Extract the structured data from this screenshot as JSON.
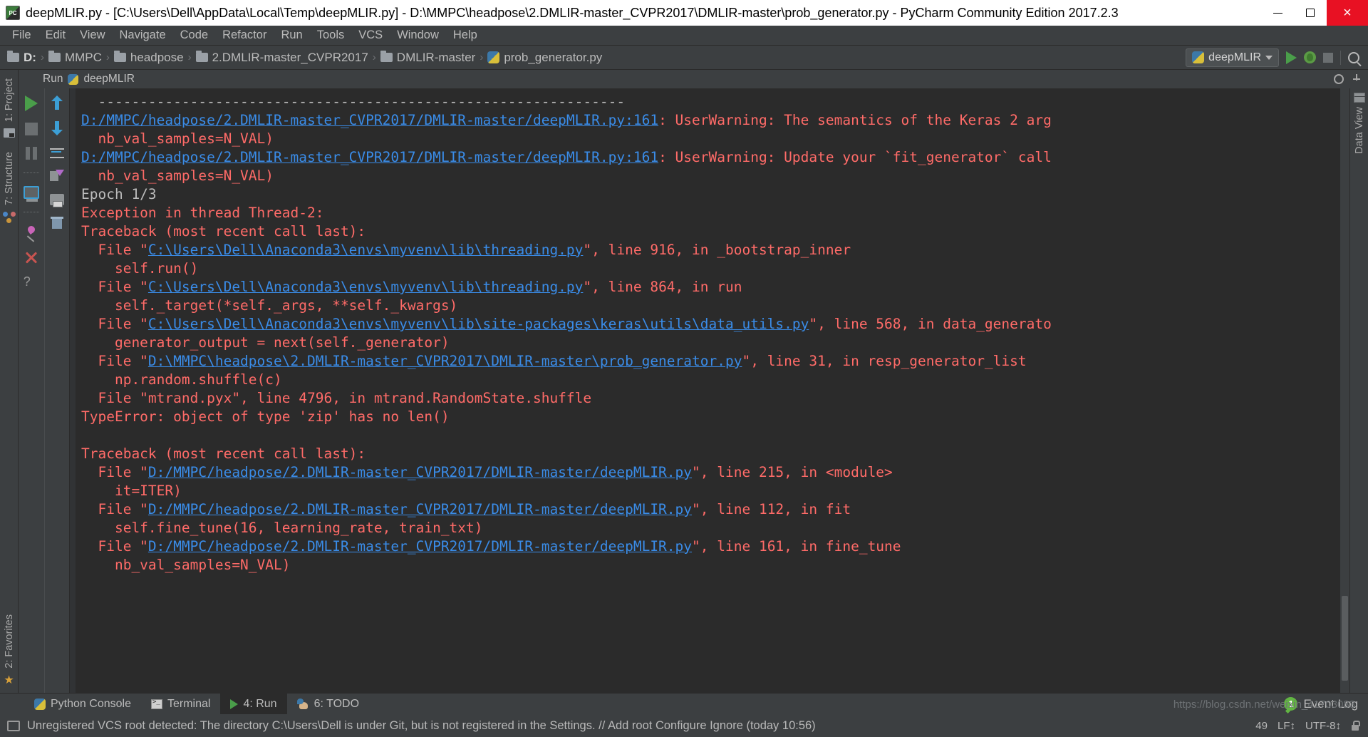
{
  "titlebar": {
    "title": "deepMLIR.py - [C:\\Users\\Dell\\AppData\\Local\\Temp\\deepMLIR.py] - D:\\MMPC\\headpose\\2.DMLIR-master_CVPR2017\\DMLIR-master\\prob_generator.py - PyCharm Community Edition 2017.2.3",
    "minimize_label": "",
    "maximize_label": "",
    "close_label": "×"
  },
  "menubar": {
    "items": [
      "File",
      "Edit",
      "View",
      "Navigate",
      "Code",
      "Refactor",
      "Run",
      "Tools",
      "VCS",
      "Window",
      "Help"
    ]
  },
  "breadcrumb": {
    "items": [
      {
        "label": "D:",
        "icon": "folder-icon"
      },
      {
        "label": "MMPC",
        "icon": "folder-icon"
      },
      {
        "label": "headpose",
        "icon": "folder-icon"
      },
      {
        "label": "2.DMLIR-master_CVPR2017",
        "icon": "folder-icon"
      },
      {
        "label": "DMLIR-master",
        "icon": "folder-icon"
      },
      {
        "label": "prob_generator.py",
        "icon": "python-file-icon"
      }
    ],
    "separator": "›"
  },
  "toolbar_right": {
    "run_config": "deepMLIR",
    "run_button": "run-icon",
    "debug_button": "debug-icon",
    "stop_button": "stop-icon",
    "search_button": "search-icon"
  },
  "left_rail": {
    "project_tab": "1: Project",
    "structure_tab": "7: Structure",
    "favorites_tab": "2: Favorites"
  },
  "right_rail": {
    "data_view_tab": "Data View"
  },
  "run_window": {
    "title": "Run",
    "config_name": "deepMLIR",
    "toolbar_col1": [
      "rerun-icon",
      "stop-icon",
      "pause-icon",
      "restart-icon",
      "pin-icon",
      "close-icon",
      "help-icon"
    ],
    "toolbar_col2": [
      "scroll-up-icon",
      "scroll-down-icon",
      "soft-wrap-icon",
      "export-icon",
      "print-icon",
      "clear-all-icon"
    ]
  },
  "console": {
    "lines": [
      [
        {
          "t": "dash",
          "s": "  ---------------------------------------------------------------"
        }
      ],
      [
        {
          "t": "link",
          "s": "D:/MMPC/headpose/2.DMLIR-master_CVPR2017/DMLIR-master/deepMLIR.py:161"
        },
        {
          "t": "err",
          "s": ": UserWarning: The semantics of the Keras 2 arg"
        }
      ],
      [
        {
          "t": "err",
          "s": "  nb_val_samples=N_VAL)"
        }
      ],
      [
        {
          "t": "link",
          "s": "D:/MMPC/headpose/2.DMLIR-master_CVPR2017/DMLIR-master/deepMLIR.py:161"
        },
        {
          "t": "err",
          "s": ": UserWarning: Update your `fit_generator` call"
        }
      ],
      [
        {
          "t": "err",
          "s": "  nb_val_samples=N_VAL)"
        }
      ],
      [
        {
          "t": "out",
          "s": "Epoch 1/3"
        }
      ],
      [
        {
          "t": "err",
          "s": "Exception in thread Thread-2:"
        }
      ],
      [
        {
          "t": "err",
          "s": "Traceback (most recent call last):"
        }
      ],
      [
        {
          "t": "err",
          "s": "  File \""
        },
        {
          "t": "link",
          "s": "C:\\Users\\Dell\\Anaconda3\\envs\\myvenv\\lib\\threading.py"
        },
        {
          "t": "err",
          "s": "\", line 916, in _bootstrap_inner"
        }
      ],
      [
        {
          "t": "err",
          "s": "    self.run()"
        }
      ],
      [
        {
          "t": "err",
          "s": "  File \""
        },
        {
          "t": "link",
          "s": "C:\\Users\\Dell\\Anaconda3\\envs\\myvenv\\lib\\threading.py"
        },
        {
          "t": "err",
          "s": "\", line 864, in run"
        }
      ],
      [
        {
          "t": "err",
          "s": "    self._target(*self._args, **self._kwargs)"
        }
      ],
      [
        {
          "t": "err",
          "s": "  File \""
        },
        {
          "t": "link",
          "s": "C:\\Users\\Dell\\Anaconda3\\envs\\myvenv\\lib\\site-packages\\keras\\utils\\data_utils.py"
        },
        {
          "t": "err",
          "s": "\", line 568, in data_generato"
        }
      ],
      [
        {
          "t": "err",
          "s": "    generator_output = next(self._generator)"
        }
      ],
      [
        {
          "t": "err",
          "s": "  File \""
        },
        {
          "t": "link",
          "s": "D:\\MMPC\\headpose\\2.DMLIR-master_CVPR2017\\DMLIR-master\\prob_generator.py"
        },
        {
          "t": "err",
          "s": "\", line 31, in resp_generator_list"
        }
      ],
      [
        {
          "t": "err",
          "s": "    np.random.shuffle(c)"
        }
      ],
      [
        {
          "t": "err",
          "s": "  File \"mtrand.pyx\", line 4796, in mtrand.RandomState.shuffle"
        }
      ],
      [
        {
          "t": "err",
          "s": "TypeError: object of type 'zip' has no len()"
        }
      ],
      [
        {
          "t": "err",
          "s": ""
        }
      ],
      [
        {
          "t": "err",
          "s": "Traceback (most recent call last):"
        }
      ],
      [
        {
          "t": "err",
          "s": "  File \""
        },
        {
          "t": "link",
          "s": "D:/MMPC/headpose/2.DMLIR-master_CVPR2017/DMLIR-master/deepMLIR.py"
        },
        {
          "t": "err",
          "s": "\", line 215, in <module>"
        }
      ],
      [
        {
          "t": "err",
          "s": "    it=ITER)"
        }
      ],
      [
        {
          "t": "err",
          "s": "  File \""
        },
        {
          "t": "link",
          "s": "D:/MMPC/headpose/2.DMLIR-master_CVPR2017/DMLIR-master/deepMLIR.py"
        },
        {
          "t": "err",
          "s": "\", line 112, in fit"
        }
      ],
      [
        {
          "t": "err",
          "s": "    self.fine_tune(16, learning_rate, train_txt)"
        }
      ],
      [
        {
          "t": "err",
          "s": "  File \""
        },
        {
          "t": "link",
          "s": "D:/MMPC/headpose/2.DMLIR-master_CVPR2017/DMLIR-master/deepMLIR.py"
        },
        {
          "t": "err",
          "s": "\", line 161, in fine_tune"
        }
      ],
      [
        {
          "t": "err",
          "s": "    nb_val_samples=N_VAL)"
        }
      ]
    ]
  },
  "bottom_tabs": {
    "items": [
      {
        "label": "Python Console",
        "icon": "python-console-icon",
        "active": false
      },
      {
        "label": "Terminal",
        "icon": "terminal-icon",
        "active": false
      },
      {
        "label": "4: Run",
        "icon": "run-icon",
        "active": true,
        "mnemonic": "4"
      },
      {
        "label": "6: TODO",
        "icon": "todo-icon",
        "active": false,
        "mnemonic": "6"
      }
    ],
    "event_log": {
      "label": "Event Log",
      "badge": "1"
    }
  },
  "statusbar": {
    "message": "Unregistered VCS root detected: The directory C:\\Users\\Dell is under Git, but is not registered in the Settings. // Add root  Configure  Ignore (today 10:56)",
    "watermark": "https://blog.csdn.net/weixin_41703083",
    "right_items": [
      "49",
      "LF↕",
      "UTF-8↕"
    ]
  },
  "colors": {
    "background": "#3c3f41",
    "console_bg": "#2b2b2b",
    "error_text": "#ff6b68",
    "link_text": "#3a8ce8",
    "normal_text": "#bbbbbb",
    "accent_green": "#62b543",
    "close_red": "#e81123"
  }
}
